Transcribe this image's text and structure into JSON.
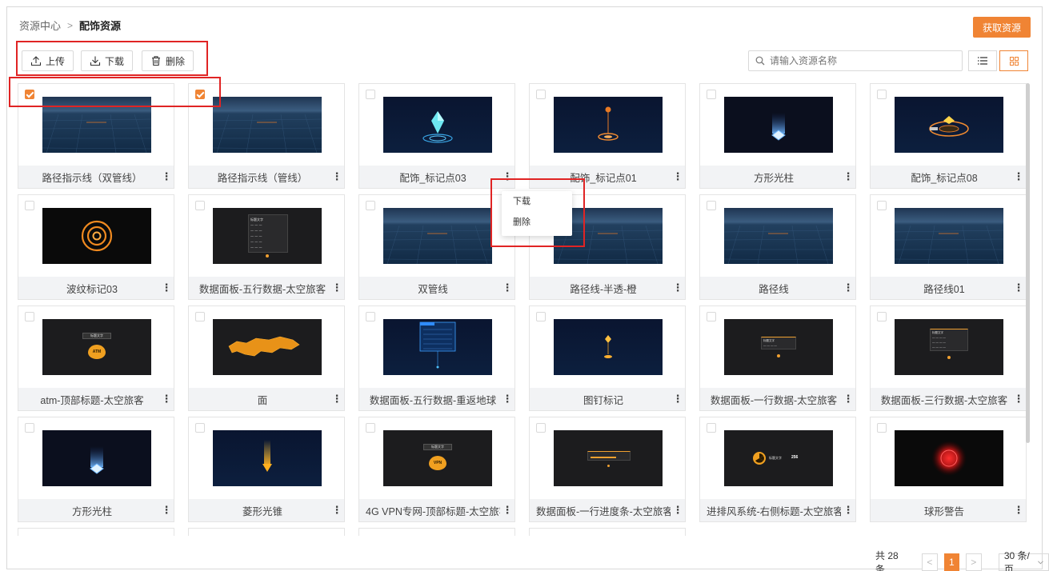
{
  "breadcrumb": {
    "root": "资源中心",
    "sep": ">",
    "current": "配饰资源"
  },
  "header": {
    "get_resource_label": "获取资源"
  },
  "toolbar": {
    "upload_label": "上传",
    "download_label": "下载",
    "delete_label": "删除"
  },
  "search": {
    "placeholder": "请输入资源名称"
  },
  "view": {
    "list_icon": "list-icon",
    "grid_icon": "grid-icon",
    "active": "grid"
  },
  "cards": [
    {
      "title": "路径指示线（双管线）",
      "checked": true,
      "thumb": "city"
    },
    {
      "title": "路径指示线（管线）",
      "checked": true,
      "thumb": "city"
    },
    {
      "title": "配饰_标记点03",
      "checked": false,
      "thumb": "diamond-marker"
    },
    {
      "title": "配饰_标记点01",
      "checked": false,
      "thumb": "pin-marker"
    },
    {
      "title": "方形光柱",
      "checked": false,
      "thumb": "square-beam"
    },
    {
      "title": "配饰_标记点08",
      "checked": false,
      "thumb": "ring-marker"
    },
    {
      "title": "波纹标记03",
      "checked": false,
      "thumb": "ripple"
    },
    {
      "title": "数据面板-五行数据-太空旅客",
      "checked": false,
      "thumb": "panel5"
    },
    {
      "title": "双管线",
      "checked": false,
      "thumb": "city"
    },
    {
      "title": "路径线-半透-橙",
      "checked": false,
      "thumb": "city"
    },
    {
      "title": "路径线",
      "checked": false,
      "thumb": "city"
    },
    {
      "title": "路径线01",
      "checked": false,
      "thumb": "city"
    },
    {
      "title": "atm-顶部标题-太空旅客",
      "checked": false,
      "thumb": "atm"
    },
    {
      "title": "面",
      "checked": false,
      "thumb": "area"
    },
    {
      "title": "数据面板-五行数据-重返地球",
      "checked": false,
      "thumb": "panel-blue"
    },
    {
      "title": "图钉标记",
      "checked": false,
      "thumb": "pushpin"
    },
    {
      "title": "数据面板-一行数据-太空旅客",
      "checked": false,
      "thumb": "panel1"
    },
    {
      "title": "数据面板-三行数据-太空旅客",
      "checked": false,
      "thumb": "panel3"
    },
    {
      "title": "方形光柱",
      "checked": false,
      "thumb": "square-beam"
    },
    {
      "title": "菱形光锥",
      "checked": false,
      "thumb": "cone"
    },
    {
      "title": "4G VPN专网-顶部标题-太空旅客",
      "checked": false,
      "thumb": "vpn"
    },
    {
      "title": "数据面板-一行进度条-太空旅客",
      "checked": false,
      "thumb": "progress"
    },
    {
      "title": "进排风系统-右侧标题-太空旅客",
      "checked": false,
      "thumb": "vent"
    },
    {
      "title": "球形警告",
      "checked": false,
      "thumb": "sphere"
    }
  ],
  "thumb_text": {
    "panel_title": "标题文字",
    "atm_badge": "ATM",
    "vpn_badge": "VPN",
    "vent_value": "256"
  },
  "context_menu": {
    "download": "下载",
    "delete": "删除"
  },
  "pagination": {
    "total": "共 28 条",
    "prev": "<",
    "page": "1",
    "next": ">",
    "page_size": "30 条/页"
  },
  "colors": {
    "accent": "#f08434",
    "highlight": "#e02424"
  }
}
